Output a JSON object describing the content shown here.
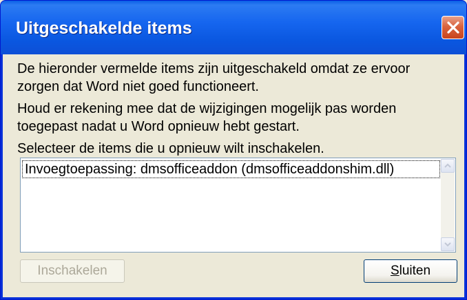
{
  "window": {
    "title": "Uitgeschakelde items"
  },
  "titlebar": {
    "close_icon": "close-icon"
  },
  "message": {
    "line1": "De hieronder vermelde items zijn uitgeschakeld omdat ze ervoor",
    "line2": "zorgen dat Word niet goed functioneert.",
    "line3": "Houd er rekening mee dat de wijzigingen mogelijk pas worden",
    "line4": "toegepast nadat u Word opnieuw hebt gestart.",
    "line5": "Selecteer de items die u opnieuw wilt inschakelen."
  },
  "list": {
    "items": [
      {
        "label": "Invoegtoepassing: dmsofficeaddon (dmsofficeaddonshim.dll)"
      }
    ]
  },
  "buttons": {
    "enable_label": "Inschakelen",
    "close_first": "S",
    "close_rest": "luiten"
  },
  "colors": {
    "titlebar": "#0a57e0",
    "close_button": "#d9643f",
    "dialog_background": "#ece9d8"
  }
}
